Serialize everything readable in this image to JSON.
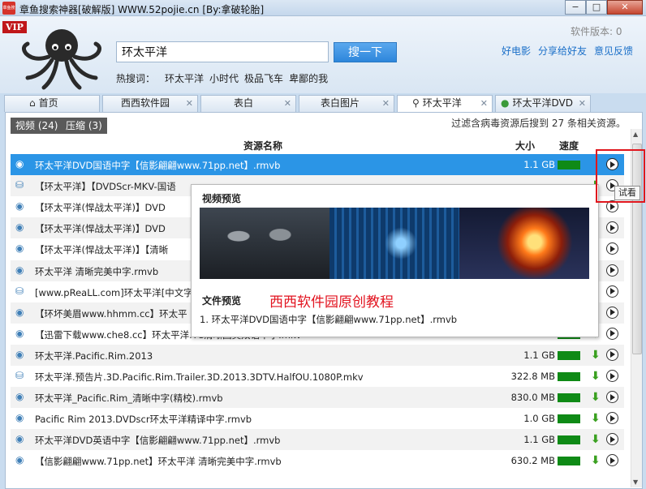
{
  "window": {
    "app_icon": "章鱼搜",
    "title": "章鱼搜索神器[破解版] WWW.52pojie.cn [By:拿破轮胎]",
    "buttons": {
      "minimize": "−",
      "maximize": "□",
      "close": "✕"
    }
  },
  "header": {
    "vip": "VIP",
    "search_value": "环太平洋",
    "search_button": "搜一下",
    "hot_label": "热搜词：",
    "hot_words": [
      "环太平洋",
      "小时代",
      "极品飞车",
      "卑鄙的我"
    ],
    "version": "软件版本: 0",
    "links": [
      "好电影",
      "分享给好友",
      "意见反馈"
    ]
  },
  "tabs": [
    {
      "label": "首页",
      "icon": "home-icon"
    },
    {
      "label": "西西软件园"
    },
    {
      "label": "表白"
    },
    {
      "label": "表白图片"
    },
    {
      "label": "环太平洋",
      "icon": "search-icon"
    },
    {
      "label": "环太平洋DVD",
      "icon": "info-icon"
    }
  ],
  "filter": {
    "video_tab": "视频 (24)",
    "zip_tab": "压缩 (3)",
    "status": "过滤含病毒资源后搜到 27 条相关资源。"
  },
  "columns": {
    "name": "资源名称",
    "size": "大小",
    "speed": "速度"
  },
  "rows": [
    {
      "name": "环太平洋DVD国语中字【信影翩翩www.71pp.net】.rmvb",
      "size": "1.1 GB",
      "icon": "disc-icon",
      "selected": true
    },
    {
      "name": "【环太平洋】【DVDScr-MKV-国语",
      "size": "",
      "icon": "network-icon"
    },
    {
      "name": "【环太平洋(悍战太平洋)】DVD",
      "size": "",
      "icon": "disc-icon"
    },
    {
      "name": "【环太平洋(悍战太平洋)】DVD",
      "size": "",
      "icon": "disc-icon"
    },
    {
      "name": "【环太平洋(悍战太平洋)】【清晰",
      "size": "",
      "icon": "disc-icon"
    },
    {
      "name": "环太平洋 清晰完美中字.rmvb",
      "size": "",
      "icon": "disc-icon"
    },
    {
      "name": "[www.pReaLL.com]环太平洋[中文字",
      "size": "",
      "icon": "network-icon"
    },
    {
      "name": "【环坏美眉www.hhmm.cc】环太平",
      "size": "",
      "icon": "disc-icon"
    },
    {
      "name": "【迅雷下载www.che8.cc】环太平洋.TC清晰国英双语中字.mkv",
      "size": "1.5 GB",
      "icon": "disc-icon"
    },
    {
      "name": "环太平洋.Pacific.Rim.2013",
      "size": "1.1 GB",
      "icon": "disc-icon"
    },
    {
      "name": "环太平洋.预告片.3D.Pacific.Rim.Trailer.3D.2013.3DTV.HalfOU.1080P.mkv",
      "size": "322.8 MB",
      "icon": "network-icon"
    },
    {
      "name": "环太平洋_Pacific.Rim_清晰中字(精校).rmvb",
      "size": "830.0 MB",
      "icon": "disc-icon"
    },
    {
      "name": "Pacific Rim 2013.DVDscr环太平洋精译中字.rmvb",
      "size": "1.0 GB",
      "icon": "disc-icon"
    },
    {
      "name": "环太平洋DVD英语中字【信影翩翩www.71pp.net】.rmvb",
      "size": "1.1 GB",
      "icon": "disc-icon"
    },
    {
      "name": "【信影翩翩www.71pp.net】环太平洋 清晰完美中字.rmvb",
      "size": "630.2 MB",
      "icon": "disc-icon"
    }
  ],
  "preview": {
    "video_title": "视频预览",
    "file_title": "文件预览",
    "watermark": "西西软件园原创教程",
    "file_item": "1.    环太平洋DVD国语中字【信影翩翩www.71pp.net】.rmvb"
  },
  "tooltip": "试看",
  "colors": {
    "accent": "#2b95e6",
    "speed": "#0f8a16",
    "highlight": "#e0161d",
    "link": "#1a6fc8"
  }
}
